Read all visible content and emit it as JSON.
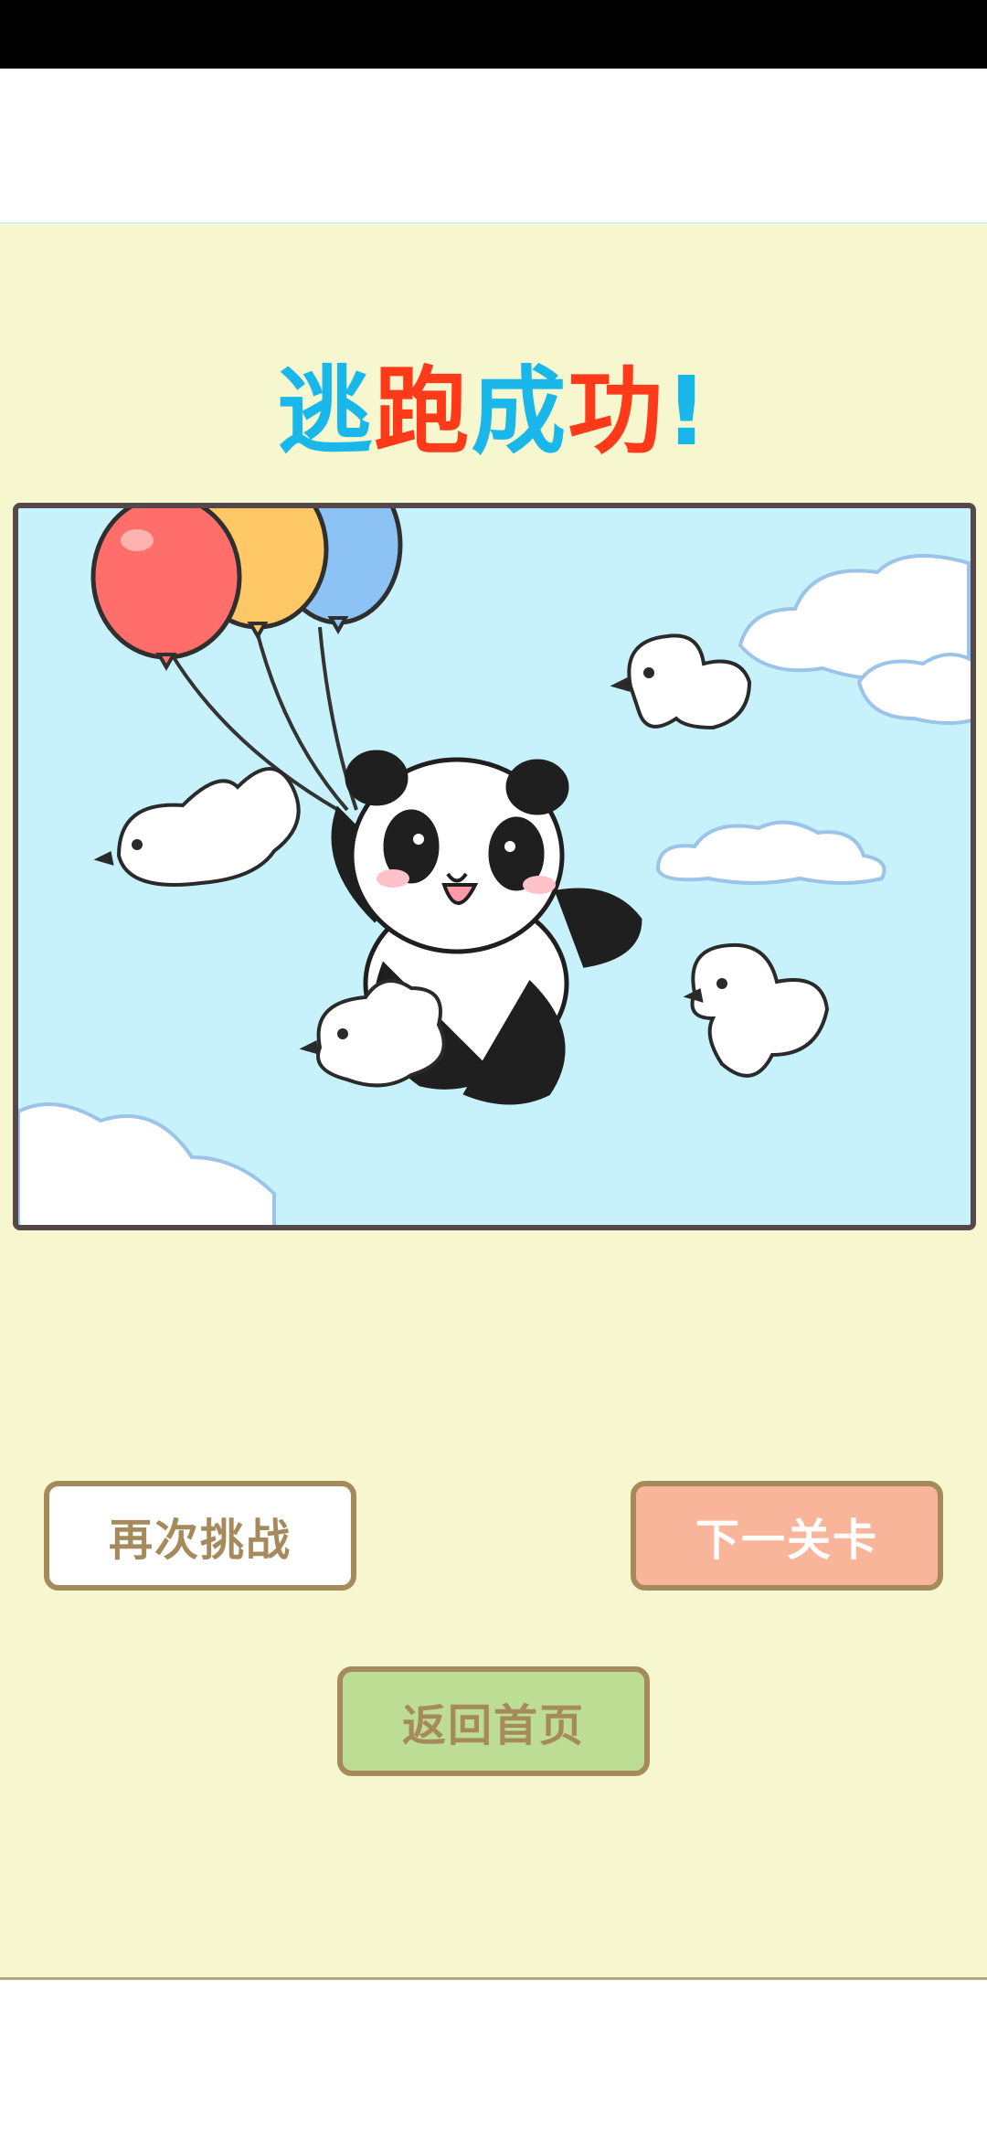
{
  "result": {
    "title_chars": [
      "逃",
      "跑",
      "成",
      "功",
      "!"
    ],
    "title_colors": [
      "#1ab8ea",
      "#ff3a1a",
      "#1ab8ea",
      "#ff3a1a",
      "#1ab8ea"
    ]
  },
  "buttons": {
    "retry_label": "再次挑战",
    "next_label": "下一关卡",
    "home_label": "返回首页"
  },
  "colors": {
    "background": "#f7f7cf",
    "sky": "#c8f2fb",
    "button_border": "#a58a5c",
    "next_button": "#f9b59a",
    "home_button": "#bedd94"
  },
  "illustration": {
    "subject": "panda-with-balloons-and-birds-icon"
  }
}
